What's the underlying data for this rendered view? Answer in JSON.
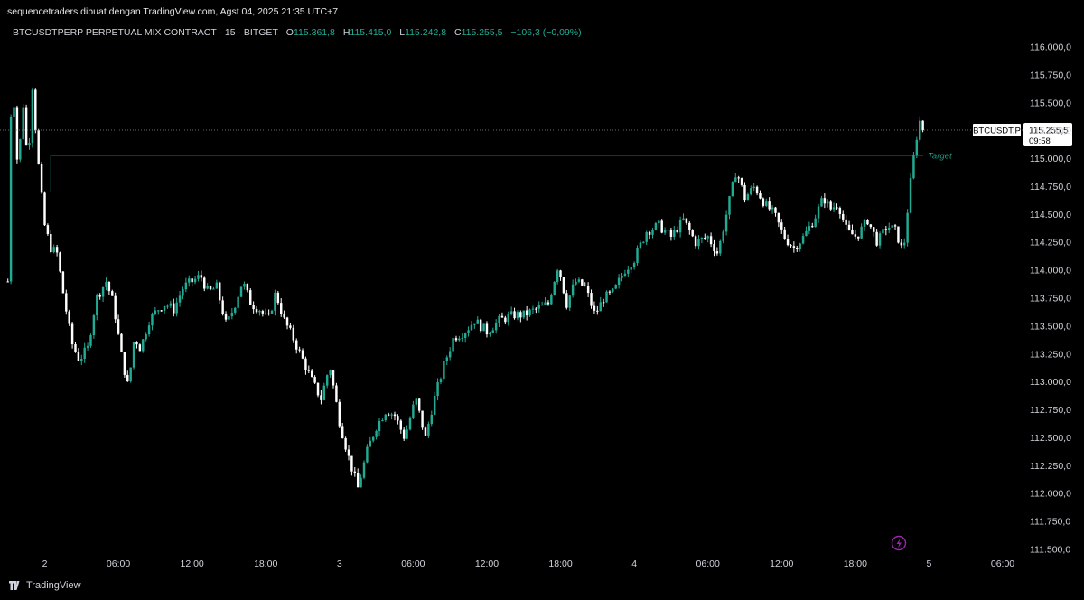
{
  "header": {
    "credit": "sequencetraders dibuat dengan TradingView.com, Agst 04, 2025 21:35 UTC+7"
  },
  "legend": {
    "symbol": "BTCUSDTPERP PERPETUAL MIX CONTRACT · 15 · BITGET",
    "open_label": "O",
    "open": "115.361,8",
    "high_label": "H",
    "high": "115.415,0",
    "low_label": "L",
    "low": "115.242,8",
    "close_label": "C",
    "close": "115.255,5",
    "change": "−106,3 (−0,09%)"
  },
  "price_tag": {
    "symbol": "BTCUSDT.P",
    "price": "115.255,5",
    "countdown": "09:58"
  },
  "target_label": "Target",
  "footer": {
    "brand": "TradingView"
  },
  "colors": {
    "up": "#22ab94",
    "down": "#ffffff",
    "background": "#000000",
    "target_line": "#1e9c84",
    "purple_badge": "#9c27b0"
  },
  "chart_data": {
    "type": "candlestick",
    "yaxis": {
      "ticks": [
        111500,
        111750,
        112000,
        112250,
        112500,
        112750,
        113000,
        113250,
        113500,
        113750,
        114000,
        114250,
        114500,
        114750,
        115000,
        115250,
        115500,
        115750,
        116000
      ],
      "tick_labels": [
        "111.500,0",
        "111.750,0",
        "112.000,0",
        "112.250,0",
        "112.500,0",
        "112.750,0",
        "113.000,0",
        "113.250,0",
        "113.500,0",
        "113.750,0",
        "114.000,0",
        "114.250,0",
        "114.500,0",
        "114.750,0",
        "115.000,0",
        "115.250,0",
        "115.500,0",
        "115.750,0",
        "116.000,0"
      ],
      "range": [
        111430,
        116180
      ]
    },
    "xaxis": {
      "tick_labels": [
        "2",
        "06:00",
        "12:00",
        "18:00",
        "3",
        "06:00",
        "12:00",
        "18:00",
        "4",
        "06:00",
        "12:00",
        "18:00",
        "5",
        "06:00"
      ],
      "tick_hours": [
        0,
        6,
        12,
        18,
        24,
        30,
        36,
        42,
        48,
        54,
        60,
        66,
        72,
        78
      ],
      "range_hours": [
        -3,
        80
      ]
    },
    "last_price": 115255.5,
    "target_price": 115030,
    "target_start_hour": 0.5,
    "anchors": [
      [
        -3.0,
        113900
      ],
      [
        -2.9,
        115100
      ],
      [
        -2.6,
        115700
      ],
      [
        -2.2,
        114900
      ],
      [
        -1.7,
        115550
      ],
      [
        -1.4,
        114900
      ],
      [
        -1.0,
        115650
      ],
      [
        -0.8,
        115350
      ],
      [
        -0.4,
        114800
      ],
      [
        0.0,
        114400
      ],
      [
        0.5,
        114200
      ],
      [
        1.0,
        114150
      ],
      [
        1.5,
        113800
      ],
      [
        2.2,
        113350
      ],
      [
        2.8,
        113200
      ],
      [
        3.5,
        113300
      ],
      [
        4.2,
        113750
      ],
      [
        5.0,
        113900
      ],
      [
        5.6,
        113700
      ],
      [
        6.3,
        113200
      ],
      [
        6.8,
        112950
      ],
      [
        7.3,
        113400
      ],
      [
        7.8,
        113300
      ],
      [
        8.5,
        113550
      ],
      [
        9.2,
        113650
      ],
      [
        9.8,
        113700
      ],
      [
        10.5,
        113650
      ],
      [
        11.3,
        113850
      ],
      [
        12.0,
        113900
      ],
      [
        12.7,
        113950
      ],
      [
        13.3,
        113800
      ],
      [
        14.0,
        113850
      ],
      [
        14.8,
        113500
      ],
      [
        15.5,
        113700
      ],
      [
        16.1,
        113900
      ],
      [
        16.8,
        113700
      ],
      [
        17.5,
        113650
      ],
      [
        18.2,
        113550
      ],
      [
        18.8,
        113800
      ],
      [
        19.5,
        113550
      ],
      [
        20.2,
        113400
      ],
      [
        21.0,
        113200
      ],
      [
        21.8,
        113000
      ],
      [
        22.5,
        112850
      ],
      [
        23.2,
        113150
      ],
      [
        24.0,
        112650
      ],
      [
        24.8,
        112300
      ],
      [
        25.5,
        112050
      ],
      [
        26.3,
        112400
      ],
      [
        27.0,
        112600
      ],
      [
        27.8,
        112750
      ],
      [
        28.5,
        112700
      ],
      [
        29.3,
        112500
      ],
      [
        30.2,
        112850
      ],
      [
        31.0,
        112500
      ],
      [
        31.6,
        112800
      ],
      [
        32.5,
        113150
      ],
      [
        33.3,
        113400
      ],
      [
        34.2,
        113450
      ],
      [
        35.0,
        113550
      ],
      [
        36.0,
        113450
      ],
      [
        37.0,
        113550
      ],
      [
        38.2,
        113600
      ],
      [
        39.0,
        113600
      ],
      [
        40.0,
        113650
      ],
      [
        41.0,
        113700
      ],
      [
        41.8,
        114050
      ],
      [
        42.5,
        113700
      ],
      [
        43.2,
        113900
      ],
      [
        44.0,
        113850
      ],
      [
        44.8,
        113600
      ],
      [
        45.5,
        113750
      ],
      [
        46.3,
        113800
      ],
      [
        47.2,
        114000
      ],
      [
        48.0,
        114100
      ],
      [
        49.0,
        114350
      ],
      [
        50.0,
        114400
      ],
      [
        51.0,
        114300
      ],
      [
        52.0,
        114450
      ],
      [
        53.0,
        114250
      ],
      [
        54.0,
        114300
      ],
      [
        54.8,
        114150
      ],
      [
        55.6,
        114550
      ],
      [
        56.3,
        114900
      ],
      [
        57.0,
        114650
      ],
      [
        57.8,
        114750
      ],
      [
        58.6,
        114600
      ],
      [
        59.4,
        114500
      ],
      [
        60.2,
        114300
      ],
      [
        61.0,
        114200
      ],
      [
        61.8,
        114300
      ],
      [
        62.6,
        114450
      ],
      [
        63.4,
        114650
      ],
      [
        64.0,
        114550
      ],
      [
        64.6,
        114600
      ],
      [
        65.3,
        114350
      ],
      [
        66.1,
        114300
      ],
      [
        67.0,
        114450
      ],
      [
        67.8,
        114250
      ],
      [
        68.6,
        114400
      ],
      [
        69.3,
        114350
      ],
      [
        69.9,
        114150
      ],
      [
        70.4,
        114700
      ],
      [
        70.8,
        115050
      ],
      [
        71.2,
        115350
      ],
      [
        71.5,
        115260
      ]
    ]
  }
}
